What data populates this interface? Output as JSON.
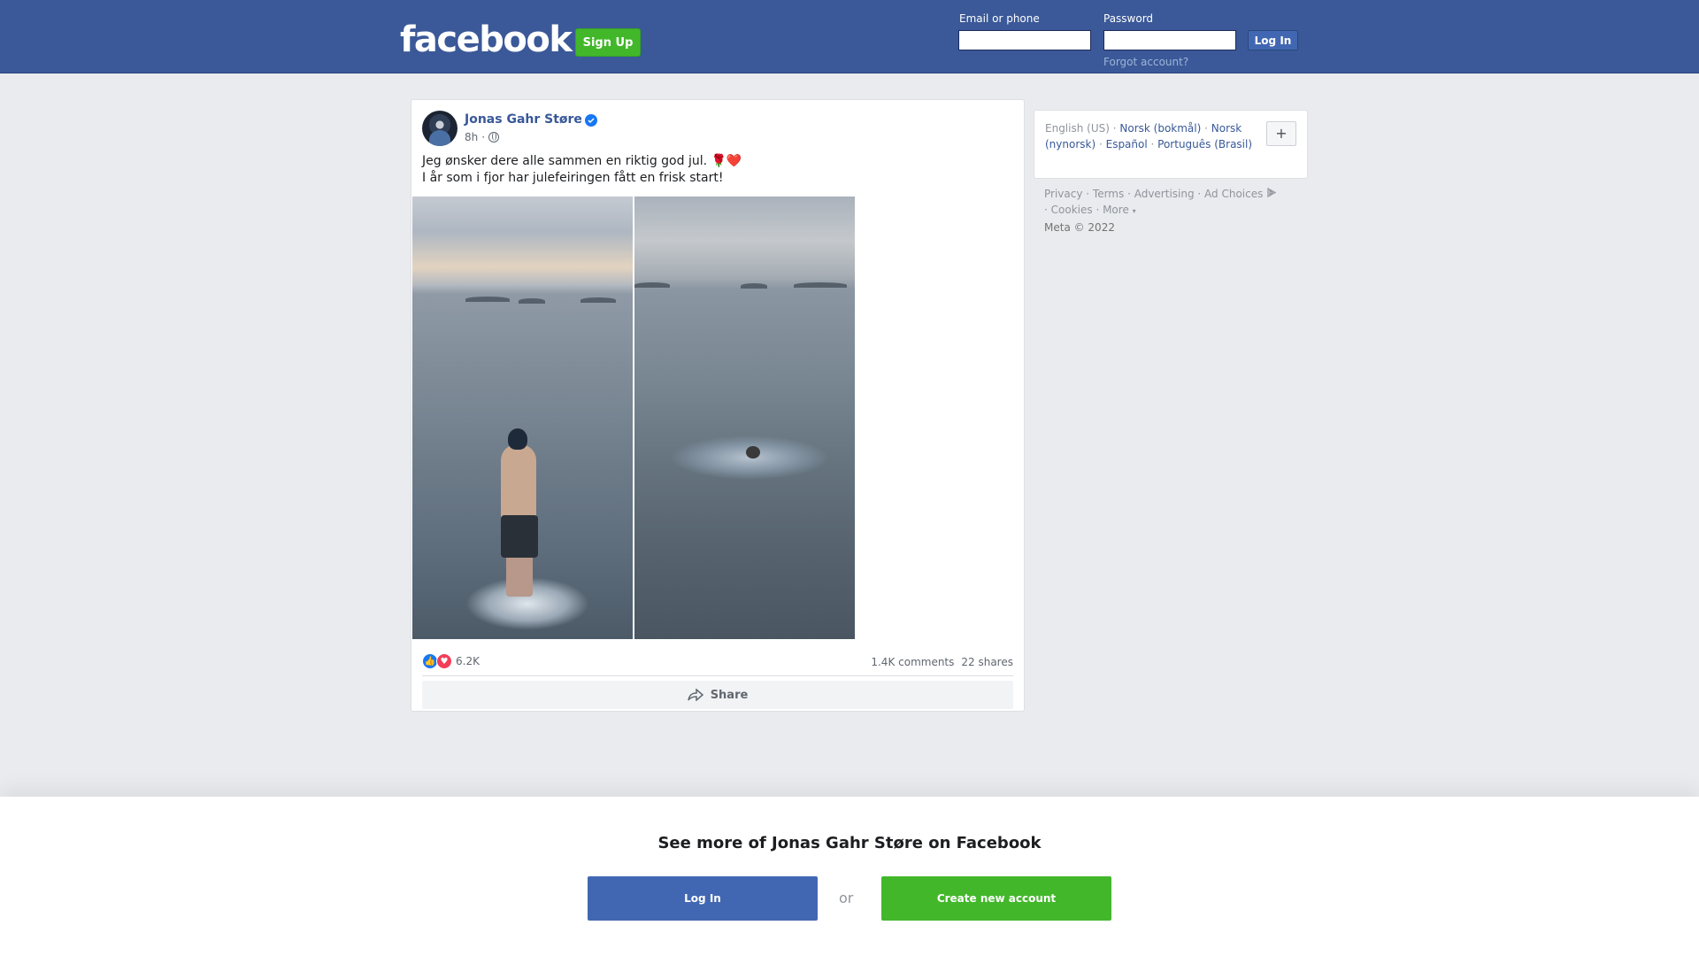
{
  "header": {
    "logo": "facebook",
    "signup_label": "Sign Up",
    "email_label": "Email or phone",
    "password_label": "Password",
    "login_label": "Log In",
    "forgot_label": "Forgot account?"
  },
  "post": {
    "author": "Jonas Gahr Støre",
    "time": "8h",
    "text_line1": "Jeg ønsker dere alle sammen en riktig god jul. 🌹❤️",
    "text_line2": "I år som i fjor har julefeiringen fått en frisk start!",
    "reaction_count": "6.2K",
    "comments": "1.4K comments",
    "shares": "22 shares",
    "share_label": "Share"
  },
  "languages": {
    "current": "English (US)",
    "items": [
      "Norsk (bokmål)",
      "Norsk (nynorsk)",
      "Español",
      "Português (Brasil)"
    ],
    "more_button": "+"
  },
  "footer": {
    "links": [
      "Privacy",
      "Terms",
      "Advertising",
      "Ad Choices",
      "Cookies",
      "More"
    ],
    "copyright": "Meta © 2022"
  },
  "overlay": {
    "title": "See more of Jonas Gahr Støre on Facebook",
    "login_label": "Log In",
    "or_label": "or",
    "create_label": "Create new account"
  },
  "colors": {
    "brand": "#3b5998",
    "green": "#42b72a",
    "link": "#385898"
  },
  "icons": [
    "verified-icon",
    "globe-icon",
    "like-icon",
    "love-icon",
    "share-icon",
    "ad-choices-icon"
  ]
}
